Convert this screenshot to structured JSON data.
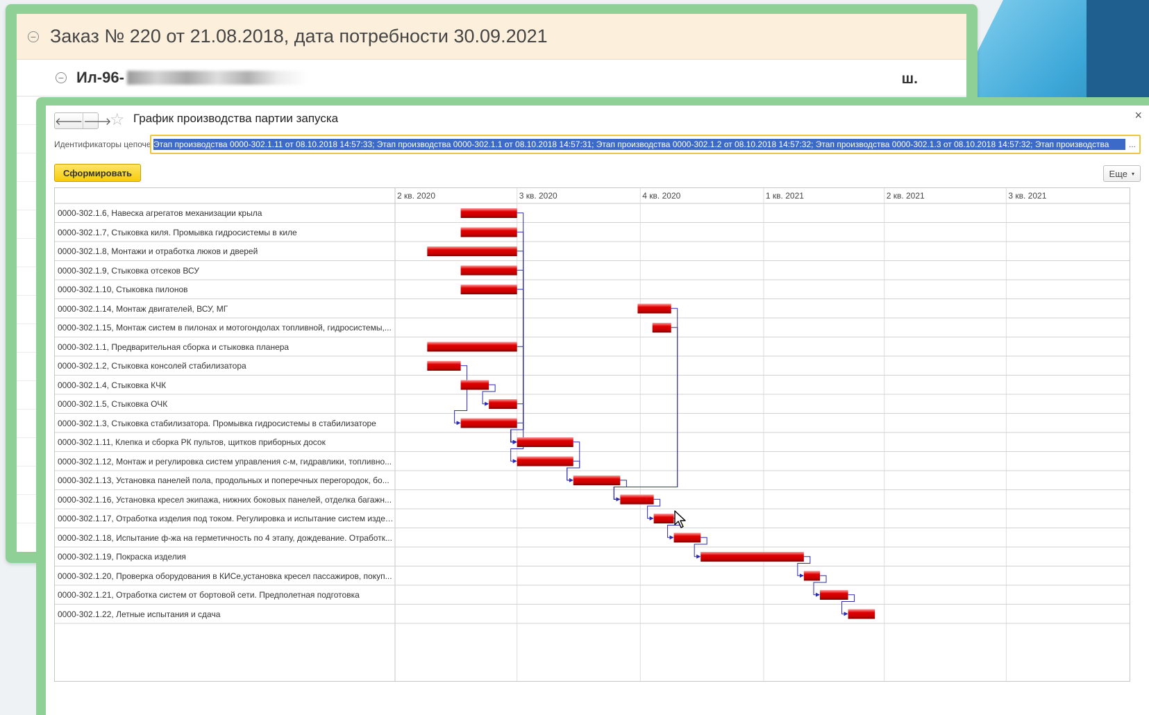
{
  "background_order": {
    "title": "Заказ № 220 от 21.08.2018, дата потребности 30.09.2021",
    "product": "Ил-96-",
    "unit": "ш."
  },
  "window": {
    "title": "График производства партии запуска",
    "close_label": "×",
    "back_label": "🡐",
    "forward_label": "🡒",
    "star_label": "☆",
    "chains_label": "Идентификаторы цепочек:",
    "chains_value": "Этап производства 0000-302.1.11 от 08.10.2018 14:57:33; Этап производства 0000-302.1.1 от 08.10.2018 14:57:31; Этап производства 0000-302.1.2 от 08.10.2018 14:57:32; Этап производства 0000-302.1.3 от 08.10.2018 14:57:32; Этап производства",
    "chains_more": "...",
    "generate_button": "Сформировать",
    "more_button": "Еще",
    "more_caret": "▾"
  },
  "colors": {
    "bar": "#e00000",
    "link": "#2a2ab4",
    "frame": "#8fd096",
    "accent_button": "#f5cc0a",
    "selection": "#3c6ac8"
  },
  "chart_data": {
    "type": "gantt",
    "timeline_quarters": [
      "2 кв. 2020",
      "3 кв. 2020",
      "4 кв. 2020",
      "1 кв. 2021",
      "2 кв. 2021",
      "3 кв. 2021"
    ],
    "timeline_start": "2020-04-01",
    "timeline_end": "2021-10-01",
    "tasks": [
      {
        "id": "0000-302.1.6",
        "label": "0000-302.1.6, Навеска агрегатов механизации крыла",
        "start": "2020-05-20",
        "end": "2020-07-01"
      },
      {
        "id": "0000-302.1.7",
        "label": "0000-302.1.7, Стыковка киля. Промывка гидросистемы в киле",
        "start": "2020-05-20",
        "end": "2020-07-01"
      },
      {
        "id": "0000-302.1.8",
        "label": "0000-302.1.8, Монтажи и отработка люков и дверей",
        "start": "2020-04-25",
        "end": "2020-07-01"
      },
      {
        "id": "0000-302.1.9",
        "label": "0000-302.1.9, Стыковка отсеков ВСУ",
        "start": "2020-05-20",
        "end": "2020-07-01"
      },
      {
        "id": "0000-302.1.10",
        "label": "0000-302.1.10, Стыковка пилонов",
        "start": "2020-05-20",
        "end": "2020-07-01"
      },
      {
        "id": "0000-302.1.14",
        "label": "0000-302.1.14, Монтаж двигателей, ВСУ, МГ",
        "start": "2020-09-29",
        "end": "2020-10-24"
      },
      {
        "id": "0000-302.1.15",
        "label": "0000-302.1.15, Монтаж систем в пилонах и мотогондолах топливной, гидросистемы,...",
        "start": "2020-10-10",
        "end": "2020-10-24"
      },
      {
        "id": "0000-302.1.1",
        "label": "0000-302.1.1, Предварительная сборка и стыковка планера",
        "start": "2020-04-25",
        "end": "2020-07-01"
      },
      {
        "id": "0000-302.1.2",
        "label": "0000-302.1.2, Стыковка консолей стабилизатора",
        "start": "2020-04-25",
        "end": "2020-05-20"
      },
      {
        "id": "0000-302.1.4",
        "label": "0000-302.1.4, Стыковка КЧК",
        "start": "2020-05-20",
        "end": "2020-06-10"
      },
      {
        "id": "0000-302.1.5",
        "label": "0000-302.1.5, Стыковка ОЧК",
        "start": "2020-06-10",
        "end": "2020-07-01"
      },
      {
        "id": "0000-302.1.3",
        "label": "0000-302.1.3, Стыковка стабилизатора. Промывка гидросистемы в стабилизаторе",
        "start": "2020-05-20",
        "end": "2020-07-01"
      },
      {
        "id": "0000-302.1.11",
        "label": "0000-302.1.11, Клепка и сборка РК пультов, щитков приборных досок",
        "start": "2020-07-01",
        "end": "2020-08-12"
      },
      {
        "id": "0000-302.1.12",
        "label": "0000-302.1.12, Монтаж и регулировка систем управления с-м, гидравлики, топливно...",
        "start": "2020-07-01",
        "end": "2020-08-12"
      },
      {
        "id": "0000-302.1.13",
        "label": "0000-302.1.13, Установка панелей пола, продольных и поперечных перегородок, бо...",
        "start": "2020-08-12",
        "end": "2020-09-16"
      },
      {
        "id": "0000-302.1.16",
        "label": "0000-302.1.16, Установка кресел экипажа, нижних боковых панелей, отделка багажн...",
        "start": "2020-09-16",
        "end": "2020-10-11"
      },
      {
        "id": "0000-302.1.17",
        "label": "0000-302.1.17, Отработка изделия под током. Регулировка и испытание систем изделия",
        "start": "2020-10-11",
        "end": "2020-10-26"
      },
      {
        "id": "0000-302.1.18",
        "label": "0000-302.1.18, Испытание ф-жа на герметичность по 4 этапу, дождевание. Отработк...",
        "start": "2020-10-26",
        "end": "2020-11-15"
      },
      {
        "id": "0000-302.1.19",
        "label": "0000-302.1.19, Покраска изделия",
        "start": "2020-11-15",
        "end": "2021-01-31"
      },
      {
        "id": "0000-302.1.20",
        "label": "0000-302.1.20, Проверка оборудования в КИСе,установка кресел пассажиров, покуп...",
        "start": "2021-01-31",
        "end": "2021-02-12"
      },
      {
        "id": "0000-302.1.21",
        "label": "0000-302.1.21, Отработка систем от бортовой сети. Предполетная подготовка",
        "start": "2021-02-12",
        "end": "2021-03-05"
      },
      {
        "id": "0000-302.1.22",
        "label": "0000-302.1.22, Летные испытания и сдача",
        "start": "2021-03-05",
        "end": "2021-03-25"
      }
    ],
    "links": [
      {
        "from": "0000-302.1.6",
        "to": "0000-302.1.11"
      },
      {
        "from": "0000-302.1.7",
        "to": "0000-302.1.11"
      },
      {
        "from": "0000-302.1.8",
        "to": "0000-302.1.11"
      },
      {
        "from": "0000-302.1.9",
        "to": "0000-302.1.11"
      },
      {
        "from": "0000-302.1.10",
        "to": "0000-302.1.11"
      },
      {
        "from": "0000-302.1.1",
        "to": "0000-302.1.11"
      },
      {
        "from": "0000-302.1.5",
        "to": "0000-302.1.11"
      },
      {
        "from": "0000-302.1.3",
        "to": "0000-302.1.12"
      },
      {
        "from": "0000-302.1.2",
        "to": "0000-302.1.3"
      },
      {
        "from": "0000-302.1.4",
        "to": "0000-302.1.5"
      },
      {
        "from": "0000-302.1.11",
        "to": "0000-302.1.13"
      },
      {
        "from": "0000-302.1.12",
        "to": "0000-302.1.13"
      },
      {
        "from": "0000-302.1.14",
        "to": "0000-302.1.16"
      },
      {
        "from": "0000-302.1.15",
        "to": "0000-302.1.16"
      },
      {
        "from": "0000-302.1.13",
        "to": "0000-302.1.16"
      },
      {
        "from": "0000-302.1.16",
        "to": "0000-302.1.17"
      },
      {
        "from": "0000-302.1.17",
        "to": "0000-302.1.18"
      },
      {
        "from": "0000-302.1.18",
        "to": "0000-302.1.19"
      },
      {
        "from": "0000-302.1.19",
        "to": "0000-302.1.20"
      },
      {
        "from": "0000-302.1.20",
        "to": "0000-302.1.21"
      },
      {
        "from": "0000-302.1.21",
        "to": "0000-302.1.22"
      }
    ]
  }
}
